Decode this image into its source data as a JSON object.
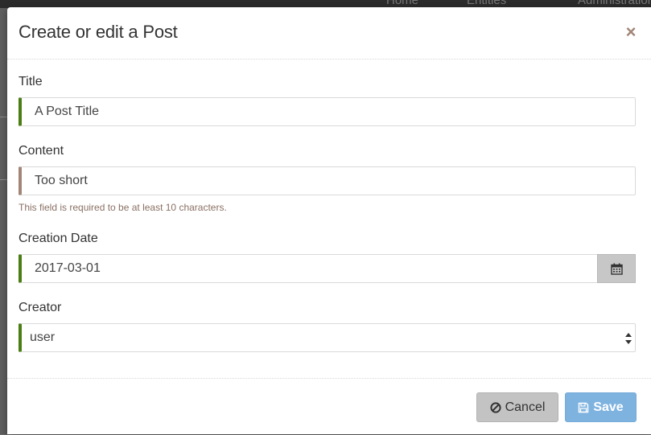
{
  "background": {
    "nav_items": [
      "Home",
      "Entities",
      "Administration"
    ]
  },
  "modal": {
    "title": "Create or edit a Post",
    "close_symbol": "×",
    "fields": {
      "title": {
        "label": "Title",
        "value": "A Post Title",
        "state": "valid"
      },
      "content": {
        "label": "Content",
        "value": "Too short",
        "state": "invalid",
        "help": "This field is required to be at least 10 characters."
      },
      "creation_date": {
        "label": "Creation Date",
        "value": "2017-03-01",
        "state": "valid",
        "button_icon": "calendar-icon"
      },
      "creator": {
        "label": "Creator",
        "value": "user",
        "state": "valid"
      }
    },
    "footer": {
      "cancel_label": "Cancel",
      "cancel_icon": "ban-icon",
      "save_label": "Save",
      "save_icon": "floppy-disk-icon"
    }
  },
  "colors": {
    "valid_border": "#4a7d12",
    "invalid_border": "#a18577",
    "save_button": "#7eb3e0",
    "cancel_button": "#c3c3c3"
  }
}
